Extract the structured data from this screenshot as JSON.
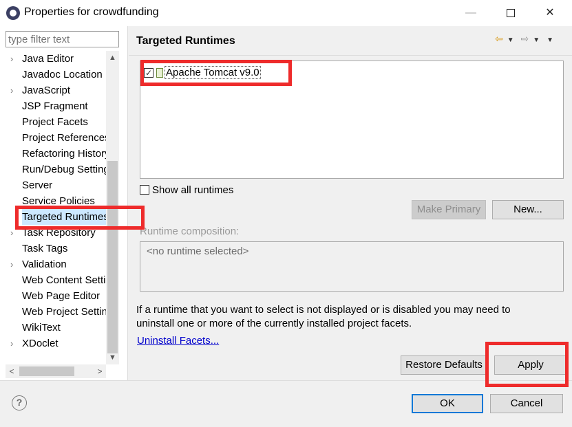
{
  "window": {
    "title": "Properties for crowdfunding",
    "minimize_glyph": "—",
    "close_glyph": "✕"
  },
  "sidebar": {
    "filter_placeholder": "type filter text",
    "items": [
      {
        "label": "Java Editor",
        "expandable": true
      },
      {
        "label": "Javadoc Location",
        "expandable": false
      },
      {
        "label": "JavaScript",
        "expandable": true
      },
      {
        "label": "JSP Fragment",
        "expandable": false
      },
      {
        "label": "Project Facets",
        "expandable": false
      },
      {
        "label": "Project References",
        "expandable": false
      },
      {
        "label": "Refactoring History",
        "expandable": false
      },
      {
        "label": "Run/Debug Settings",
        "expandable": false
      },
      {
        "label": "Server",
        "expandable": false
      },
      {
        "label": "Service Policies",
        "expandable": false
      },
      {
        "label": "Targeted Runtimes",
        "expandable": false,
        "selected": true
      },
      {
        "label": "Task Repository",
        "expandable": true
      },
      {
        "label": "Task Tags",
        "expandable": false
      },
      {
        "label": "Validation",
        "expandable": true
      },
      {
        "label": "Web Content Settings",
        "expandable": false
      },
      {
        "label": "Web Page Editor",
        "expandable": false
      },
      {
        "label": "Web Project Settings",
        "expandable": false
      },
      {
        "label": "WikiText",
        "expandable": false
      },
      {
        "label": "XDoclet",
        "expandable": true
      }
    ]
  },
  "main": {
    "title": "Targeted Runtimes",
    "runtimes": [
      {
        "label": "Apache Tomcat v9.0",
        "checked": true
      }
    ],
    "show_all_label": "Show all runtimes",
    "make_primary_label": "Make Primary",
    "new_label": "New...",
    "composition_label": "Runtime composition:",
    "composition_empty": "<no runtime selected>",
    "info_line1": "If a runtime that you want to select is not displayed or is disabled you may need to",
    "info_line2": "uninstall one or more of the currently installed project facets.",
    "uninstall_link": "Uninstall Facets...",
    "restore_defaults_label": "Restore Defaults",
    "apply_label": "Apply"
  },
  "footer": {
    "ok_label": "OK",
    "cancel_label": "Cancel"
  },
  "colors": {
    "highlight": "#ee2b2b",
    "selection": "#cde8ff",
    "link": "#0000cc"
  }
}
